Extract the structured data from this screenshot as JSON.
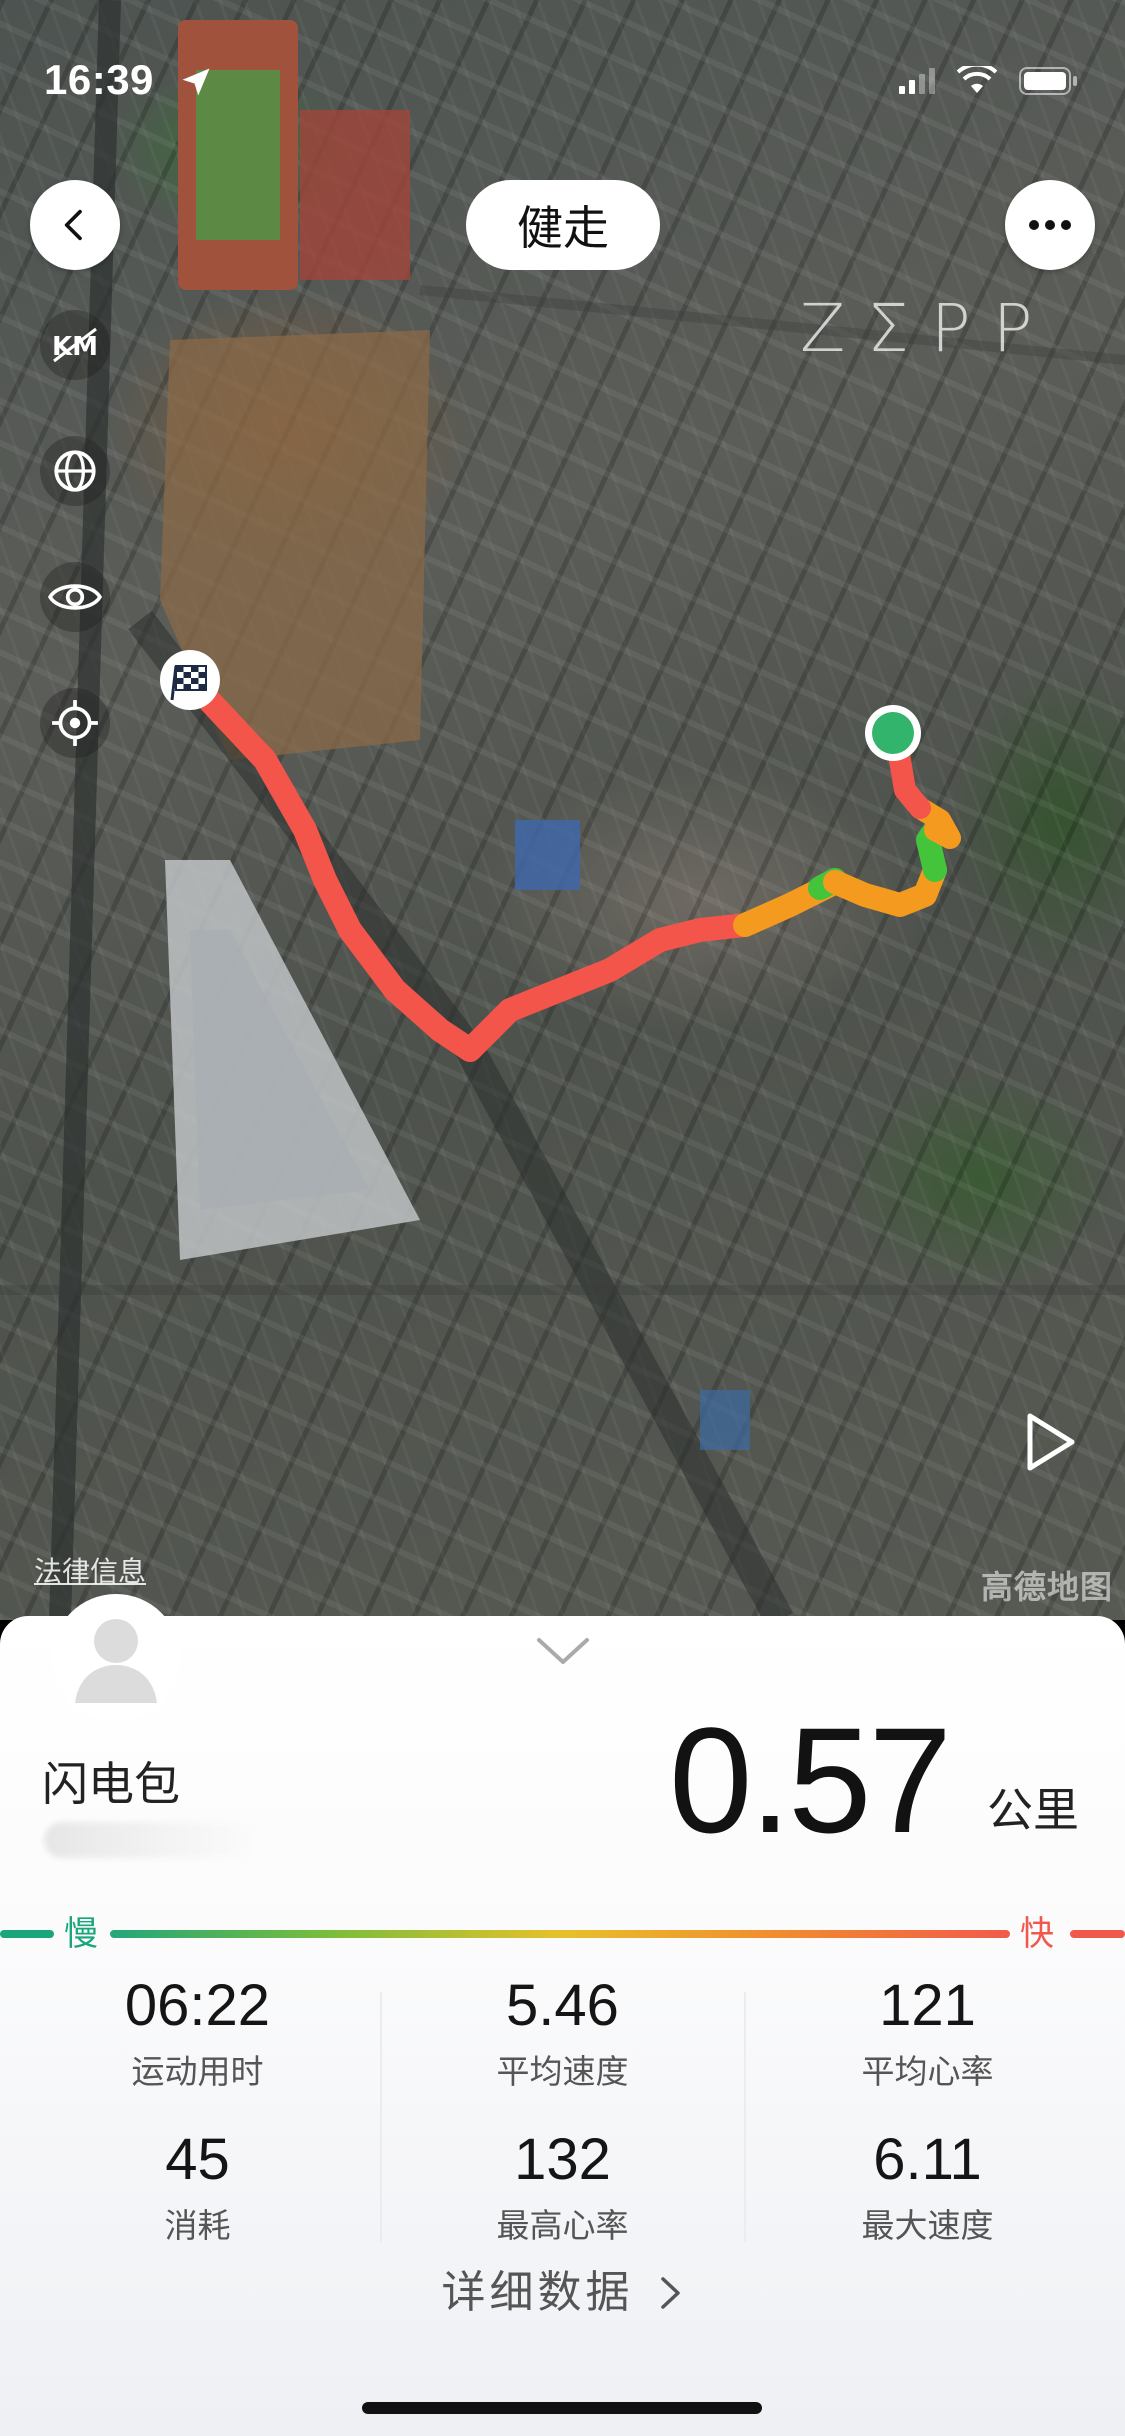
{
  "status_bar": {
    "time": "16:39",
    "location_icon": "location-arrow-icon",
    "signal_icon": "signal-icon",
    "wifi_icon": "wifi-icon",
    "battery_icon": "battery-icon"
  },
  "header": {
    "title": "健走",
    "back_icon": "chevron-left-icon",
    "more_icon": "more-horizontal-icon",
    "brand": "ZƩPP"
  },
  "map": {
    "side_icons": [
      "km-marker-icon",
      "globe-icon",
      "eye-icon",
      "locate-icon"
    ],
    "legal_link": "法律信息",
    "provider": "高德地图",
    "start_marker": "green-start-dot",
    "finish_marker": "checkered-flag-icon",
    "play_icon": "play-icon"
  },
  "colors": {
    "slow": "#1aa67c",
    "fast": "#f1584c",
    "route_red": "#f4554a",
    "route_orange": "#f39a1f",
    "route_green": "#43c43a"
  },
  "summary": {
    "user_name": "闪电包",
    "distance": "0.57",
    "unit": "公里",
    "slow_label": "慢",
    "fast_label": "快"
  },
  "stats": [
    {
      "value": "06:22",
      "label": "运动用时"
    },
    {
      "value": "5.46",
      "label": "平均速度"
    },
    {
      "value": "121",
      "label": "平均心率"
    },
    {
      "value": "45",
      "label": "消耗"
    },
    {
      "value": "132",
      "label": "最高心率"
    },
    {
      "value": "6.11",
      "label": "最大速度"
    }
  ],
  "detail_link": "详细数据"
}
